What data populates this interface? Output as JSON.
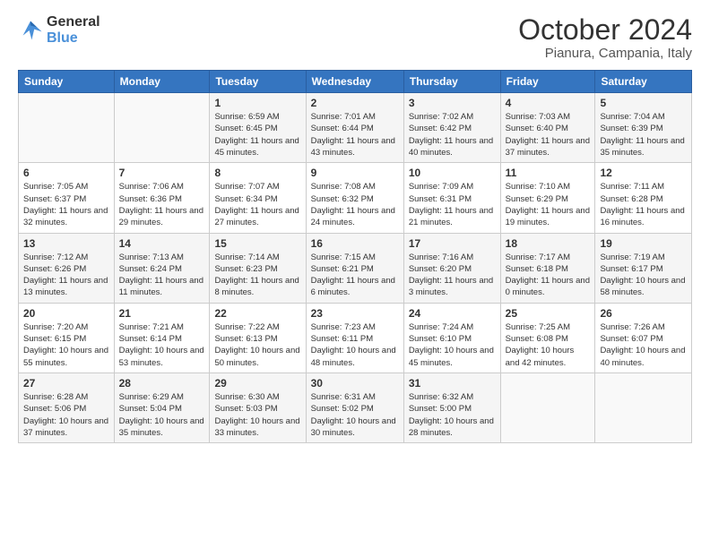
{
  "header": {
    "logo_line1": "General",
    "logo_line2": "Blue",
    "month": "October 2024",
    "location": "Pianura, Campania, Italy"
  },
  "days_of_week": [
    "Sunday",
    "Monday",
    "Tuesday",
    "Wednesday",
    "Thursday",
    "Friday",
    "Saturday"
  ],
  "weeks": [
    [
      {
        "num": "",
        "info": ""
      },
      {
        "num": "",
        "info": ""
      },
      {
        "num": "1",
        "info": "Sunrise: 6:59 AM\nSunset: 6:45 PM\nDaylight: 11 hours and 45 minutes."
      },
      {
        "num": "2",
        "info": "Sunrise: 7:01 AM\nSunset: 6:44 PM\nDaylight: 11 hours and 43 minutes."
      },
      {
        "num": "3",
        "info": "Sunrise: 7:02 AM\nSunset: 6:42 PM\nDaylight: 11 hours and 40 minutes."
      },
      {
        "num": "4",
        "info": "Sunrise: 7:03 AM\nSunset: 6:40 PM\nDaylight: 11 hours and 37 minutes."
      },
      {
        "num": "5",
        "info": "Sunrise: 7:04 AM\nSunset: 6:39 PM\nDaylight: 11 hours and 35 minutes."
      }
    ],
    [
      {
        "num": "6",
        "info": "Sunrise: 7:05 AM\nSunset: 6:37 PM\nDaylight: 11 hours and 32 minutes."
      },
      {
        "num": "7",
        "info": "Sunrise: 7:06 AM\nSunset: 6:36 PM\nDaylight: 11 hours and 29 minutes."
      },
      {
        "num": "8",
        "info": "Sunrise: 7:07 AM\nSunset: 6:34 PM\nDaylight: 11 hours and 27 minutes."
      },
      {
        "num": "9",
        "info": "Sunrise: 7:08 AM\nSunset: 6:32 PM\nDaylight: 11 hours and 24 minutes."
      },
      {
        "num": "10",
        "info": "Sunrise: 7:09 AM\nSunset: 6:31 PM\nDaylight: 11 hours and 21 minutes."
      },
      {
        "num": "11",
        "info": "Sunrise: 7:10 AM\nSunset: 6:29 PM\nDaylight: 11 hours and 19 minutes."
      },
      {
        "num": "12",
        "info": "Sunrise: 7:11 AM\nSunset: 6:28 PM\nDaylight: 11 hours and 16 minutes."
      }
    ],
    [
      {
        "num": "13",
        "info": "Sunrise: 7:12 AM\nSunset: 6:26 PM\nDaylight: 11 hours and 13 minutes."
      },
      {
        "num": "14",
        "info": "Sunrise: 7:13 AM\nSunset: 6:24 PM\nDaylight: 11 hours and 11 minutes."
      },
      {
        "num": "15",
        "info": "Sunrise: 7:14 AM\nSunset: 6:23 PM\nDaylight: 11 hours and 8 minutes."
      },
      {
        "num": "16",
        "info": "Sunrise: 7:15 AM\nSunset: 6:21 PM\nDaylight: 11 hours and 6 minutes."
      },
      {
        "num": "17",
        "info": "Sunrise: 7:16 AM\nSunset: 6:20 PM\nDaylight: 11 hours and 3 minutes."
      },
      {
        "num": "18",
        "info": "Sunrise: 7:17 AM\nSunset: 6:18 PM\nDaylight: 11 hours and 0 minutes."
      },
      {
        "num": "19",
        "info": "Sunrise: 7:19 AM\nSunset: 6:17 PM\nDaylight: 10 hours and 58 minutes."
      }
    ],
    [
      {
        "num": "20",
        "info": "Sunrise: 7:20 AM\nSunset: 6:15 PM\nDaylight: 10 hours and 55 minutes."
      },
      {
        "num": "21",
        "info": "Sunrise: 7:21 AM\nSunset: 6:14 PM\nDaylight: 10 hours and 53 minutes."
      },
      {
        "num": "22",
        "info": "Sunrise: 7:22 AM\nSunset: 6:13 PM\nDaylight: 10 hours and 50 minutes."
      },
      {
        "num": "23",
        "info": "Sunrise: 7:23 AM\nSunset: 6:11 PM\nDaylight: 10 hours and 48 minutes."
      },
      {
        "num": "24",
        "info": "Sunrise: 7:24 AM\nSunset: 6:10 PM\nDaylight: 10 hours and 45 minutes."
      },
      {
        "num": "25",
        "info": "Sunrise: 7:25 AM\nSunset: 6:08 PM\nDaylight: 10 hours and 42 minutes."
      },
      {
        "num": "26",
        "info": "Sunrise: 7:26 AM\nSunset: 6:07 PM\nDaylight: 10 hours and 40 minutes."
      }
    ],
    [
      {
        "num": "27",
        "info": "Sunrise: 6:28 AM\nSunset: 5:06 PM\nDaylight: 10 hours and 37 minutes."
      },
      {
        "num": "28",
        "info": "Sunrise: 6:29 AM\nSunset: 5:04 PM\nDaylight: 10 hours and 35 minutes."
      },
      {
        "num": "29",
        "info": "Sunrise: 6:30 AM\nSunset: 5:03 PM\nDaylight: 10 hours and 33 minutes."
      },
      {
        "num": "30",
        "info": "Sunrise: 6:31 AM\nSunset: 5:02 PM\nDaylight: 10 hours and 30 minutes."
      },
      {
        "num": "31",
        "info": "Sunrise: 6:32 AM\nSunset: 5:00 PM\nDaylight: 10 hours and 28 minutes."
      },
      {
        "num": "",
        "info": ""
      },
      {
        "num": "",
        "info": ""
      }
    ]
  ]
}
